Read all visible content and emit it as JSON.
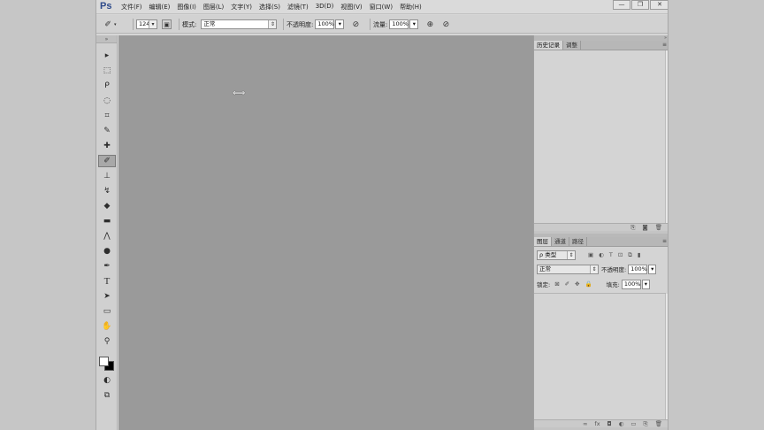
{
  "app": {
    "logo": "Ps",
    "menu": [
      "文件(F)",
      "编辑(E)",
      "图像(I)",
      "图层(L)",
      "文字(Y)",
      "选择(S)",
      "滤镜(T)",
      "3D(D)",
      "视图(V)",
      "窗口(W)",
      "帮助(H)"
    ],
    "window_controls": {
      "minimize": "—",
      "restore": "❐",
      "close": "✕"
    }
  },
  "options": {
    "brush_size": "124",
    "mode_label": "模式:",
    "mode_value": "正常",
    "opacity_label": "不透明度:",
    "opacity_value": "100%",
    "flow_label": "流量:",
    "flow_value": "100%"
  },
  "toolbox": {
    "tools": [
      {
        "name": "move-tool",
        "glyph": "▸"
      },
      {
        "name": "marquee-tool",
        "glyph": "⬚"
      },
      {
        "name": "lasso-tool",
        "glyph": "ᑭ"
      },
      {
        "name": "quick-select-tool",
        "glyph": "◌"
      },
      {
        "name": "crop-tool",
        "glyph": "⌗"
      },
      {
        "name": "eyedropper-tool",
        "glyph": "✎"
      },
      {
        "name": "healing-tool",
        "glyph": "✚"
      },
      {
        "name": "brush-tool",
        "glyph": "✐"
      },
      {
        "name": "stamp-tool",
        "glyph": "⊥"
      },
      {
        "name": "history-brush-tool",
        "glyph": "↯"
      },
      {
        "name": "eraser-tool",
        "glyph": "◆"
      },
      {
        "name": "gradient-tool",
        "glyph": "▬"
      },
      {
        "name": "blur-tool",
        "glyph": "⋀"
      },
      {
        "name": "dodge-tool",
        "glyph": "●"
      },
      {
        "name": "pen-tool",
        "glyph": "✒"
      },
      {
        "name": "type-tool",
        "glyph": "T"
      },
      {
        "name": "path-select-tool",
        "glyph": "➤"
      },
      {
        "name": "shape-tool",
        "glyph": "▭"
      },
      {
        "name": "hand-tool",
        "glyph": "✋"
      },
      {
        "name": "zoom-tool",
        "glyph": "⚲"
      }
    ],
    "quick_mask_glyph": "◐",
    "screen_mode_glyph": "⧉"
  },
  "history_panel": {
    "tabs": [
      "历史记录",
      "调整"
    ]
  },
  "layers_panel": {
    "tabs": [
      "图层",
      "通道",
      "路径"
    ],
    "filter_kind": "ρ 类型",
    "blend_mode": "正常",
    "opacity_label": "不透明度:",
    "opacity_value": "100%",
    "lock_label": "锁定:",
    "fill_label": "填充:",
    "fill_value": "100%"
  }
}
